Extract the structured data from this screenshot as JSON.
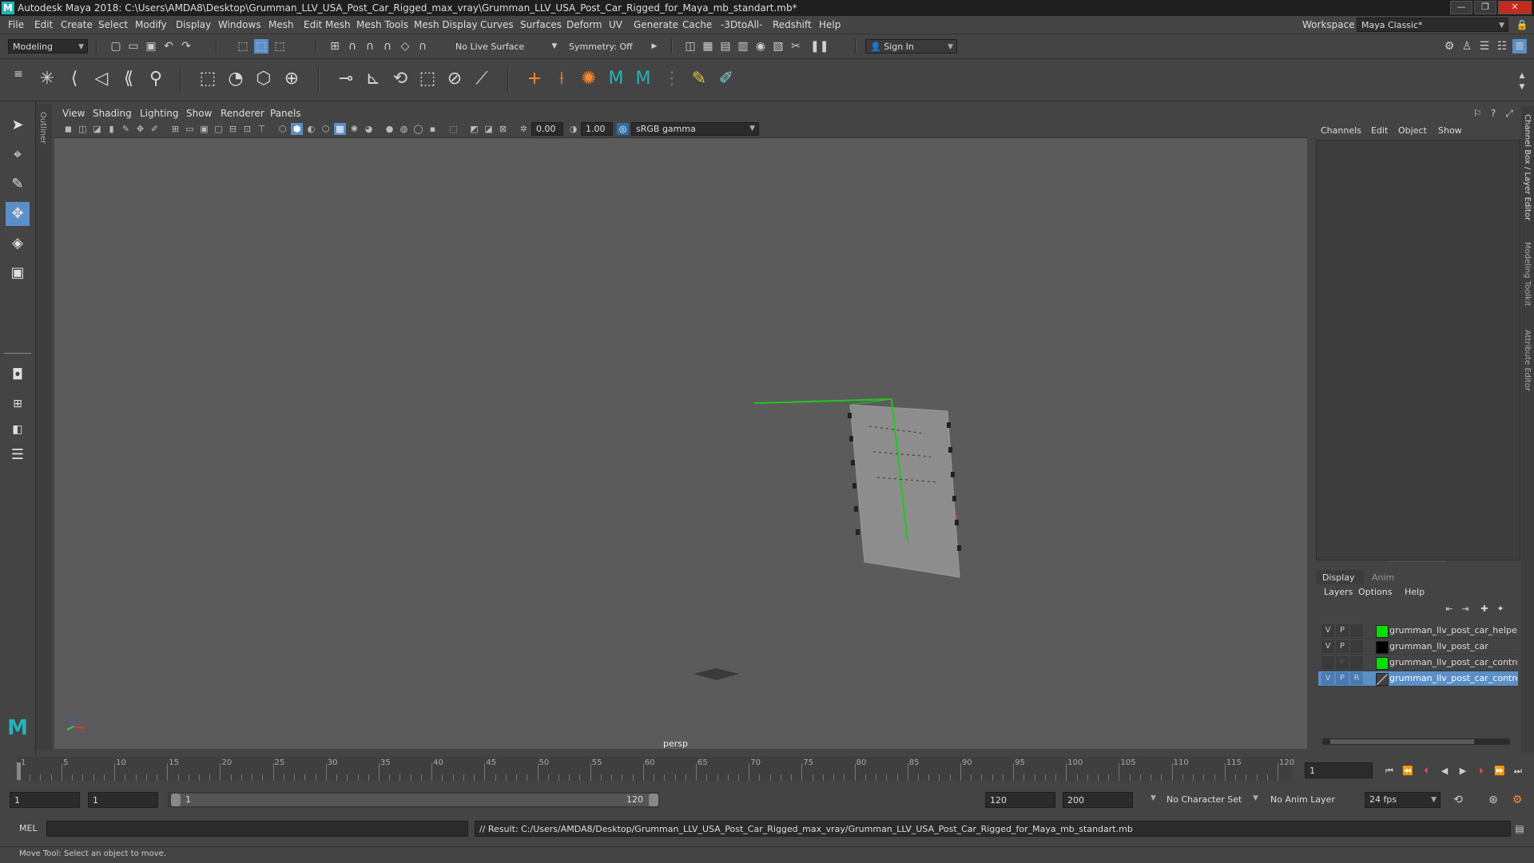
{
  "title_bar": {
    "logo": "M",
    "title": "Autodesk Maya 2018: C:\\Users\\AMDA8\\Desktop\\Grumman_LLV_USA_Post_Car_Rigged_max_vray\\Grumman_LLV_USA_Post_Car_Rigged_for_Maya_mb_standart.mb*",
    "minimize": "—",
    "maximize": "❐",
    "close": "✕"
  },
  "menu_bar": {
    "items": [
      "File",
      "Edit",
      "Create",
      "Select",
      "Modify",
      "Display",
      "Windows",
      "Mesh",
      "Edit Mesh",
      "Mesh Tools",
      "Mesh Display",
      "Curves",
      "Surfaces",
      "Deform",
      "UV",
      "Generate",
      "Cache",
      "-3DtoAll-",
      "Redshift",
      "Help"
    ],
    "workspace_label": "Workspace :",
    "workspace_value": "Maya Classic*"
  },
  "status_line": {
    "mode": "Modeling",
    "live_surface": "No Live Surface",
    "symmetry": "Symmetry: Off",
    "sign_in": "Sign In"
  },
  "panel": {
    "menus": [
      "View",
      "Shading",
      "Lighting",
      "Show",
      "Renderer",
      "Panels"
    ],
    "exposure": "0.00",
    "gamma": "1.00",
    "color_space": "sRGB gamma",
    "camera_label": "persp"
  },
  "outliner_tab": "Outliner",
  "channel_box": {
    "tabs": [
      "Channels",
      "Edit",
      "Object",
      "Show"
    ]
  },
  "layer_editor": {
    "tabs": [
      "Display",
      "Anim"
    ],
    "menus": [
      "Layers",
      "Options",
      "Help"
    ],
    "layers": [
      {
        "v": "V",
        "p": "P",
        "r": "",
        "color": "#00e000",
        "name": "grumman_llv_post_car_helpers",
        "selected": false
      },
      {
        "v": "V",
        "p": "P",
        "r": "",
        "color": "#000000",
        "name": "grumman_llv_post_car",
        "selected": false
      },
      {
        "v": "",
        "p": "P",
        "r": "",
        "color": "#00e000",
        "name": "grumman_llv_post_car_controllers",
        "selected": false
      },
      {
        "v": "V",
        "p": "P",
        "r": "R",
        "color": "#404040",
        "name": "grumman_llv_post_car_controllers",
        "selected": true
      }
    ]
  },
  "side_tabs": [
    "Channel Box / Layer Editor",
    "Modeling Toolkit",
    "Attribute Editor"
  ],
  "timeline": {
    "ticks": [
      "1",
      "5",
      "10",
      "15",
      "20",
      "25",
      "30",
      "35",
      "40",
      "45",
      "50",
      "55",
      "60",
      "65",
      "70",
      "75",
      "80",
      "85",
      "90",
      "95",
      "100",
      "105",
      "110",
      "115",
      "120"
    ],
    "current_frame": "1"
  },
  "range": {
    "start": "1",
    "playback_start": "1",
    "slider_start": "1",
    "slider_end": "120",
    "playback_end": "120",
    "end": "200",
    "character_set": "No Character Set",
    "anim_layer": "No Anim Layer",
    "fps": "24 fps"
  },
  "command_line": {
    "label": "MEL",
    "result": "// Result: C:/Users/AMDA8/Desktop/Grumman_LLV_USA_Post_Car_Rigged_max_vray/Grumman_LLV_USA_Post_Car_Rigged_for_Maya_mb_standart.mb"
  },
  "help_line": "Move Tool: Select an object to move.",
  "colors": {
    "viewport_bg": "#5b5b5b",
    "ui_bg": "#444444",
    "accent": "#5b8fc7",
    "maya_teal": "#26b3b8"
  }
}
